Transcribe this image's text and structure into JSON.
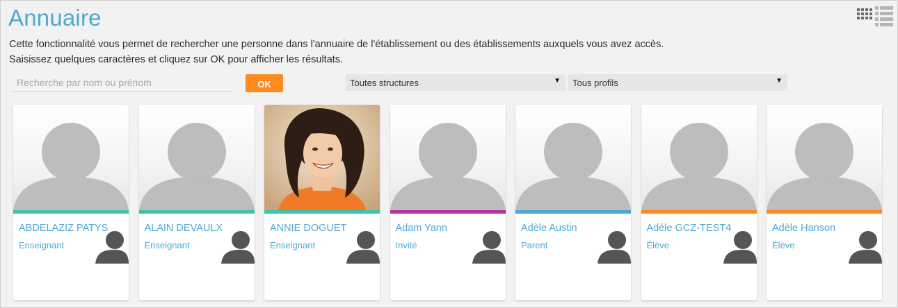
{
  "page": {
    "title": "Annuaire",
    "description_line1": "Cette fonctionnalité vous permet de rechercher une personne dans l'annuaire de l'établissement ou des établissements auxquels vous avez accès.",
    "description_line2": "Saisissez quelques caractères et cliquez sur OK pour afficher les résultats."
  },
  "view_toggle": {
    "grid_icon": "grid-view-icon",
    "list_icon": "list-view-icon"
  },
  "search": {
    "placeholder": "Recherche par nom ou prénom",
    "value": "",
    "ok_label": "OK"
  },
  "filters": {
    "structure": {
      "selected": "Toutes structures"
    },
    "profile": {
      "selected": "Tous profils"
    }
  },
  "colors": {
    "title": "#4ea8d5",
    "ok_button": "#ff8a1e",
    "enseignant": "#3fc3a9",
    "invite": "#b72fa6",
    "parent": "#4ea8d5",
    "eleve": "#ff8a1e"
  },
  "users": [
    {
      "name": "ABDELAZIZ PATYS",
      "profile": "Enseignant",
      "color": "#3fc3a9",
      "photo": "default-avatar"
    },
    {
      "name": "ALAIN DEVAULX",
      "profile": "Enseignant",
      "color": "#3fc3a9",
      "photo": "default-avatar"
    },
    {
      "name": "ANNIE DOGUET",
      "profile": "Enseignant",
      "color": "#3fc3a9",
      "photo": "portrait-photo"
    },
    {
      "name": "Adam Yann",
      "profile": "Invité",
      "color": "#b72fa6",
      "photo": "default-avatar"
    },
    {
      "name": "Adèle Austin",
      "profile": "Parent",
      "color": "#4ea8d5",
      "photo": "default-avatar"
    },
    {
      "name": "Adèle GCZ-TEST4",
      "profile": "Élève",
      "color": "#ff8a1e",
      "photo": "default-avatar"
    },
    {
      "name": "Adèle Hanson",
      "profile": "Élève",
      "color": "#ff8a1e",
      "photo": "default-avatar"
    }
  ]
}
